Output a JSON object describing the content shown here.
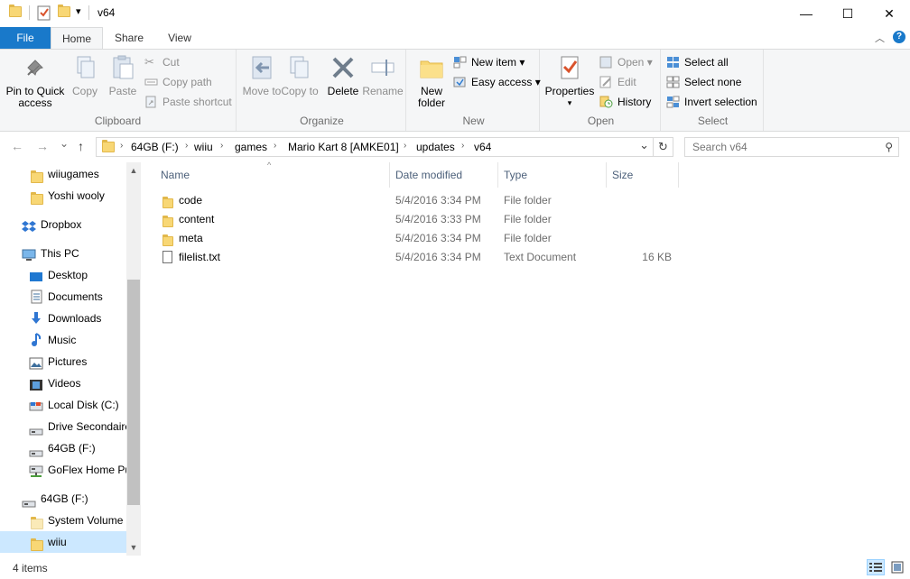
{
  "window": {
    "title": "v64",
    "minimize_glyph": "—",
    "maximize_glyph": "☐",
    "close_glyph": "✕",
    "qat_dropdown_glyph": "▾"
  },
  "ribbon_tabs": {
    "file": "File",
    "home": "Home",
    "share": "Share",
    "view": "View",
    "collapse_glyph": "︿",
    "help_glyph": "?"
  },
  "ribbon": {
    "clipboard": {
      "label": "Clipboard",
      "pin_label": "Pin to Quick access",
      "copy_label": "Copy",
      "paste_label": "Paste",
      "cut_label": "Cut",
      "copy_path_label": "Copy path",
      "paste_shortcut_label": "Paste shortcut"
    },
    "organize": {
      "label": "Organize",
      "move_to_label": "Move to",
      "copy_to_label": "Copy to",
      "delete_label": "Delete",
      "rename_label": "Rename"
    },
    "new": {
      "label": "New",
      "new_folder_label": "New folder",
      "new_item_label": "New item",
      "easy_access_label": "Easy access"
    },
    "open": {
      "label": "Open",
      "properties_label": "Properties",
      "open_label": "Open",
      "edit_label": "Edit",
      "history_label": "History"
    },
    "select": {
      "label": "Select",
      "select_all_label": "Select all",
      "select_none_label": "Select none",
      "invert_selection_label": "Invert selection"
    }
  },
  "address": {
    "back_glyph": "←",
    "forward_glyph": "→",
    "recent_glyph": "⌄",
    "up_glyph": "↑",
    "breadcrumbs": [
      "64GB (F:)",
      "wiiu",
      "games",
      "Mario Kart 8 [AMKE01]",
      "updates",
      "v64"
    ],
    "separator_glyph": "›",
    "dropdown_glyph": "⌄",
    "refresh_glyph": "↻",
    "search_placeholder": "Search v64",
    "search_glyph": "⚲"
  },
  "nav_pane": {
    "items": [
      {
        "label": "wiiugames",
        "icon": "folder-icon"
      },
      {
        "label": "Yoshi wooly",
        "icon": "folder-icon"
      },
      {
        "label": "Dropbox",
        "icon": "dropbox-icon"
      },
      {
        "label": "This PC",
        "icon": "computer-icon"
      },
      {
        "label": "Desktop",
        "icon": "desktop-icon"
      },
      {
        "label": "Documents",
        "icon": "documents-icon"
      },
      {
        "label": "Downloads",
        "icon": "downloads-icon"
      },
      {
        "label": "Music",
        "icon": "music-icon"
      },
      {
        "label": "Pictures",
        "icon": "pictures-icon"
      },
      {
        "label": "Videos",
        "icon": "videos-icon"
      },
      {
        "label": "Local Disk (C:)",
        "icon": "local-disk-icon"
      },
      {
        "label": "Drive Secondaire",
        "icon": "drive-icon"
      },
      {
        "label": "64GB (F:)",
        "icon": "drive-icon"
      },
      {
        "label": "GoFlex Home Pu",
        "icon": "network-drive-icon"
      },
      {
        "label": "64GB (F:)",
        "icon": "drive-icon"
      },
      {
        "label": "System Volume I",
        "icon": "folder-icon"
      },
      {
        "label": "wiiu",
        "icon": "folder-icon"
      }
    ],
    "scroll_up_glyph": "▲",
    "scroll_down_glyph": "▼"
  },
  "file_list": {
    "columns": {
      "name": "Name",
      "date_modified": "Date modified",
      "type": "Type",
      "size": "Size"
    },
    "sort_glyph": "^",
    "rows": [
      {
        "name": "code",
        "date": "5/4/2016 3:34 PM",
        "type": "File folder",
        "size": "",
        "icon": "folder-icon"
      },
      {
        "name": "content",
        "date": "5/4/2016 3:33 PM",
        "type": "File folder",
        "size": "",
        "icon": "folder-icon"
      },
      {
        "name": "meta",
        "date": "5/4/2016 3:34 PM",
        "type": "File folder",
        "size": "",
        "icon": "folder-icon"
      },
      {
        "name": "filelist.txt",
        "date": "5/4/2016 3:34 PM",
        "type": "Text Document",
        "size": "16 KB",
        "icon": "text-document-icon"
      }
    ]
  },
  "status_bar": {
    "item_count": "4 items"
  },
  "colors": {
    "accent": "#1979ca",
    "folder": "#f8d775",
    "selection": "#cce8ff"
  }
}
